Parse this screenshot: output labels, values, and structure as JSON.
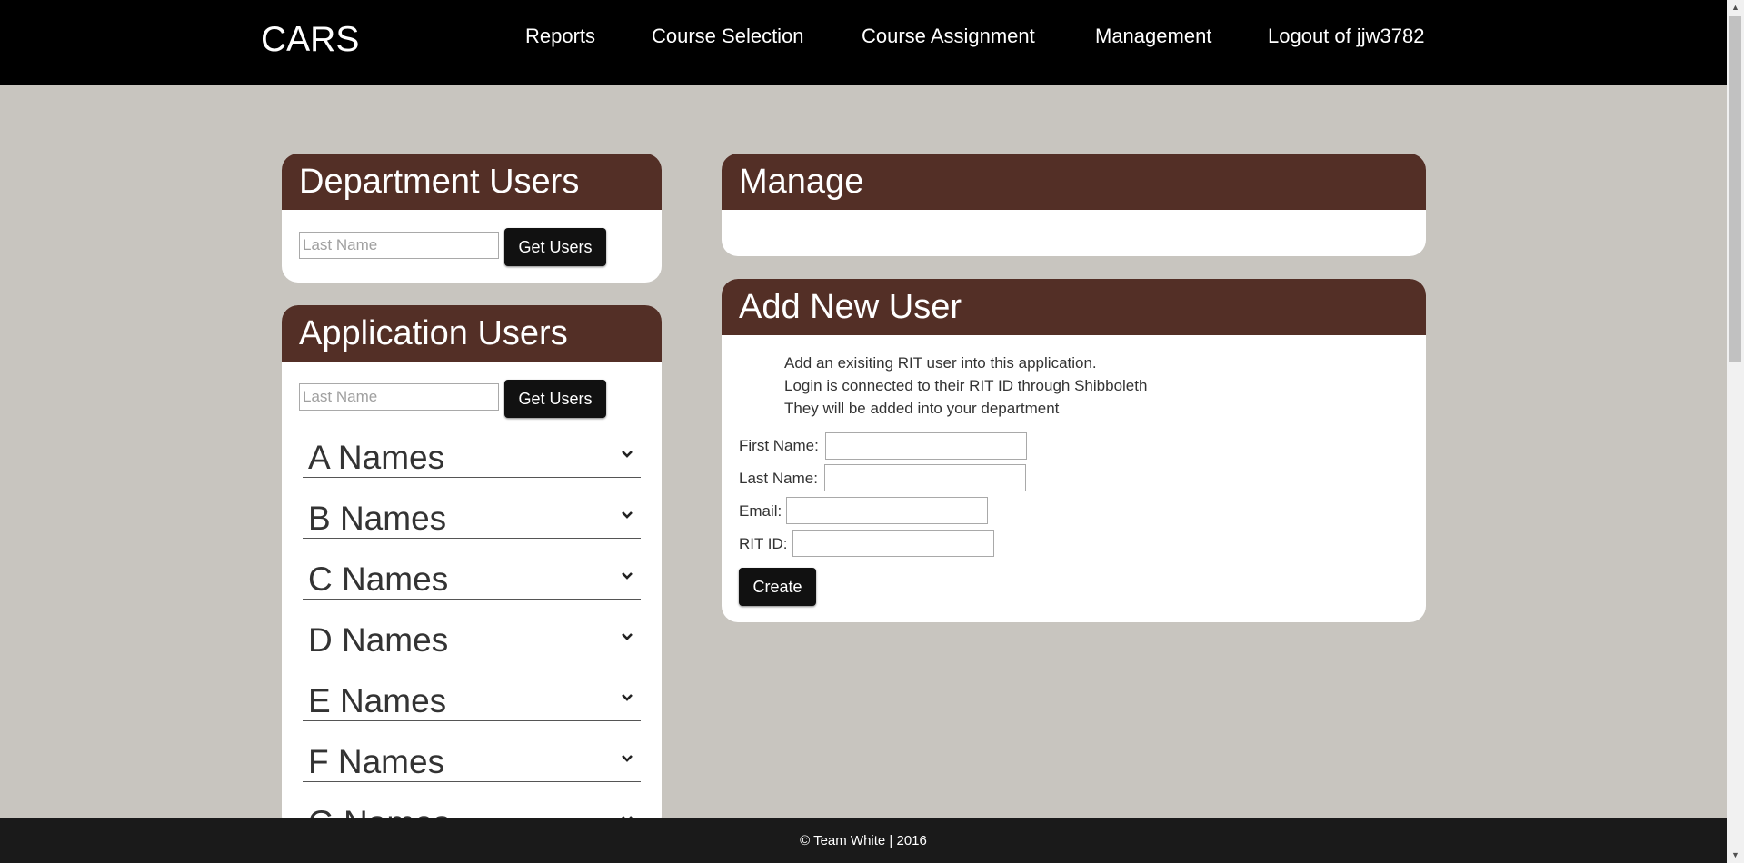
{
  "app": {
    "brand": "CARS"
  },
  "nav": {
    "reports": "Reports",
    "course_selection": "Course Selection",
    "course_assignment": "Course Assignment",
    "management": "Management",
    "logout": "Logout of jjw3782"
  },
  "department_users": {
    "title": "Department Users",
    "placeholder": "Last Name",
    "button": "Get Users"
  },
  "application_users": {
    "title": "Application Users",
    "placeholder": "Last Name",
    "button": "Get Users",
    "groups": [
      "A Names",
      "B Names",
      "C Names",
      "D Names",
      "E Names",
      "F Names",
      "G Names"
    ]
  },
  "manage": {
    "title": "Manage"
  },
  "add_user": {
    "title": "Add New User",
    "description": [
      "Add an exisiting RIT user into this application.",
      "Login is connected to their RIT ID through Shibboleth",
      "They will be added into your department"
    ],
    "fields": {
      "first_name": "First Name:",
      "last_name": "Last Name:",
      "email": "Email:",
      "rit_id": "RIT ID:"
    },
    "button": "Create"
  },
  "footer": {
    "text": "© Team White | 2016"
  },
  "colors": {
    "header_bg": "#000000",
    "panel_head": "#532f26",
    "page_bg": "#c8c5bf",
    "footer_bg": "#1a1a1a"
  }
}
